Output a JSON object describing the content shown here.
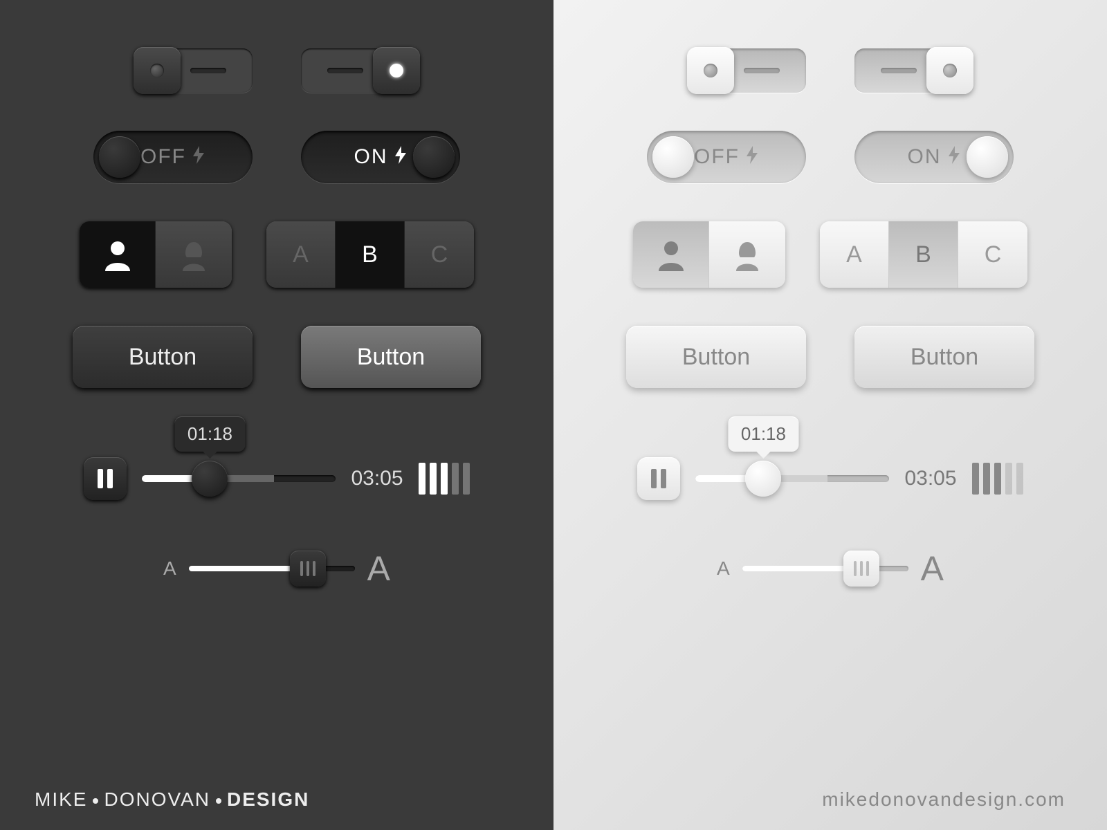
{
  "toggles": {
    "off_label": "OFF",
    "on_label": "ON",
    "bolt": "⚡"
  },
  "segment_people": {
    "male_icon": "person-male-icon",
    "female_icon": "person-female-icon"
  },
  "segment_abc": {
    "a": "A",
    "b": "B",
    "c": "C"
  },
  "buttons": {
    "label": "Button"
  },
  "media": {
    "elapsed": "01:18",
    "total": "03:05"
  },
  "sizeSlider": {
    "small": "A",
    "big": "A"
  },
  "footer": {
    "dark_a": "MIKE",
    "dark_b": "DONOVAN",
    "dark_c": "DESIGN",
    "light": "mikedonovandesign.com"
  }
}
